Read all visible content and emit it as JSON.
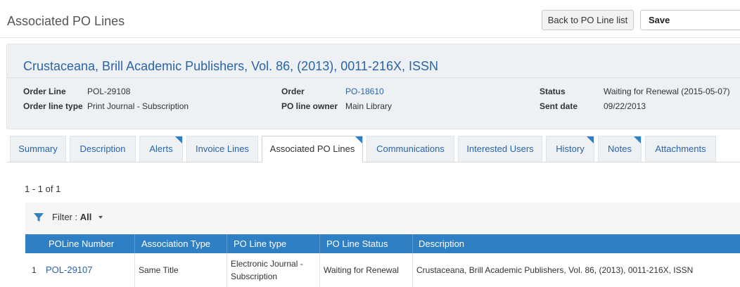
{
  "page": {
    "title": "Associated PO Lines",
    "back_button": "Back to PO Line list",
    "save_button": "Save"
  },
  "record": {
    "title": "Crustaceana, Brill Academic Publishers, Vol. 86, (2013), 0011-216X, ISSN",
    "fields": {
      "order_line_label": "Order Line",
      "order_line_value": "POL-29108",
      "order_line_type_label": "Order line type",
      "order_line_type_value": "Print Journal - Subscription",
      "order_label": "Order",
      "order_value": "PO-18610",
      "po_line_owner_label": "PO line owner",
      "po_line_owner_value": "Main Library",
      "status_label": "Status",
      "status_value": "Waiting for Renewal (2015-05-07)",
      "sent_date_label": "Sent date",
      "sent_date_value": "09/22/2013"
    }
  },
  "tabs": [
    {
      "label": "Summary",
      "active": false,
      "flag": false
    },
    {
      "label": "Description",
      "active": false,
      "flag": false
    },
    {
      "label": "Alerts",
      "active": false,
      "flag": true
    },
    {
      "label": "Invoice Lines",
      "active": false,
      "flag": false
    },
    {
      "label": "Associated PO Lines",
      "active": true,
      "flag": true
    },
    {
      "label": "Communications",
      "active": false,
      "flag": false
    },
    {
      "label": "Interested Users",
      "active": false,
      "flag": false
    },
    {
      "label": "History",
      "active": false,
      "flag": true
    },
    {
      "label": "Notes",
      "active": false,
      "flag": true
    },
    {
      "label": "Attachments",
      "active": false,
      "flag": false
    }
  ],
  "list": {
    "pagination": "1 - 1 of 1",
    "filter_label": "Filter :",
    "filter_value": "All",
    "columns": [
      "POLine Number",
      "Association Type",
      "PO Line type",
      "PO Line Status",
      "Description"
    ],
    "rows": [
      {
        "index": "1",
        "poline_number": "POL-29107",
        "association_type": "Same Title",
        "po_line_type_line1": "Electronic Journal -",
        "po_line_type_line2": "Subscription",
        "po_line_status": "Waiting for Renewal",
        "description": "Crustaceana, Brill Academic Publishers, Vol. 86, (2013), 0011-216X, ISSN"
      }
    ]
  },
  "colors": {
    "accent": "#2f7fc4",
    "link": "#2a64a8",
    "header_bg": "#eef1f4"
  },
  "icons": [
    "filter-icon",
    "chevron-down-icon",
    "tab-corner-flag-icon"
  ]
}
